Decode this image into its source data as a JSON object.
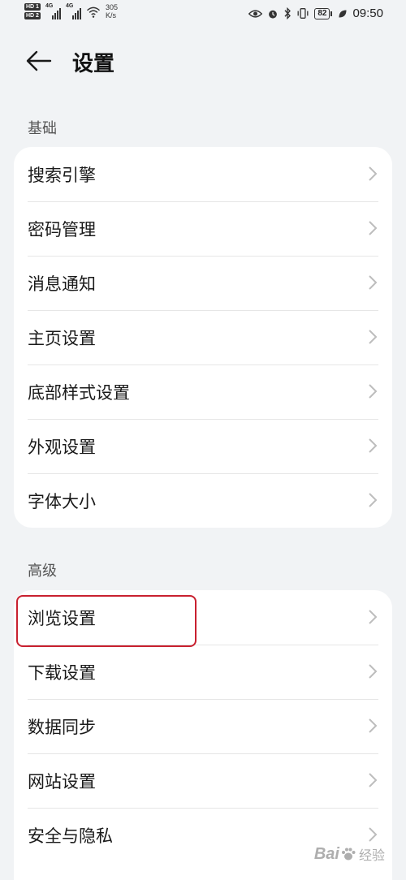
{
  "status_bar": {
    "hd1": "HD 1",
    "hd2": "HD 2",
    "sim1_type": "4G",
    "sim2_type": "4G",
    "net_speed_value": "305",
    "net_speed_unit": "K/s",
    "battery": "82",
    "time": "09:50"
  },
  "header": {
    "title": "设置"
  },
  "sections": {
    "basic": {
      "title": "基础",
      "items": [
        "搜索引擎",
        "密码管理",
        "消息通知",
        "主页设置",
        "底部样式设置",
        "外观设置",
        "字体大小"
      ]
    },
    "advanced": {
      "title": "高级",
      "items": [
        "浏览设置",
        "下载设置",
        "数据同步",
        "网站设置",
        "安全与隐私"
      ]
    }
  },
  "watermark": {
    "logo": "Bai",
    "text": "经验"
  },
  "colors": {
    "background": "#f1f3f5",
    "card": "#ffffff",
    "highlight": "#c8202f"
  }
}
